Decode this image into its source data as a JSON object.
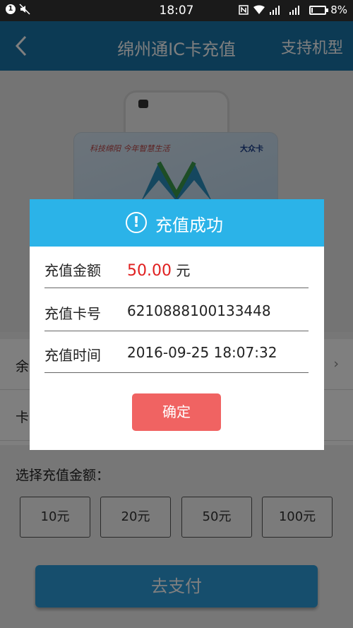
{
  "status_bar": {
    "time": "18:07",
    "battery": "8%",
    "battery_level": 0.08,
    "left_icons": [
      "notification-1-icon",
      "mute-icon"
    ],
    "right_icons": [
      "nfc-icon",
      "wifi-icon",
      "signal-icon",
      "signal-icon",
      "battery-icon"
    ]
  },
  "header": {
    "title": "绵州通IC卡充值",
    "support_label": "支持机型"
  },
  "card": {
    "slogan": "科技绵阳 今年智慧生活",
    "brand": "大众卡"
  },
  "info_rows": [
    {
      "label": "余"
    },
    {
      "label": "卡"
    }
  ],
  "amount_section": {
    "label": "选择充值金额：",
    "options": [
      "10元",
      "20元",
      "50元",
      "100元"
    ]
  },
  "pay_button": "去支付",
  "dialog": {
    "title": "充值成功",
    "rows": [
      {
        "key": "充值金额",
        "value": "50.00",
        "unit": "元"
      },
      {
        "key": "充值卡号",
        "value": "6210888100133448"
      },
      {
        "key": "充值时间",
        "value": "2016-09-25 18:07:32"
      }
    ],
    "confirm_label": "确定"
  },
  "colors": {
    "header_bg": "#1874a9",
    "dialog_header": "#2bb3e8",
    "confirm_bg": "#f06362",
    "amount_red": "#e02020"
  }
}
